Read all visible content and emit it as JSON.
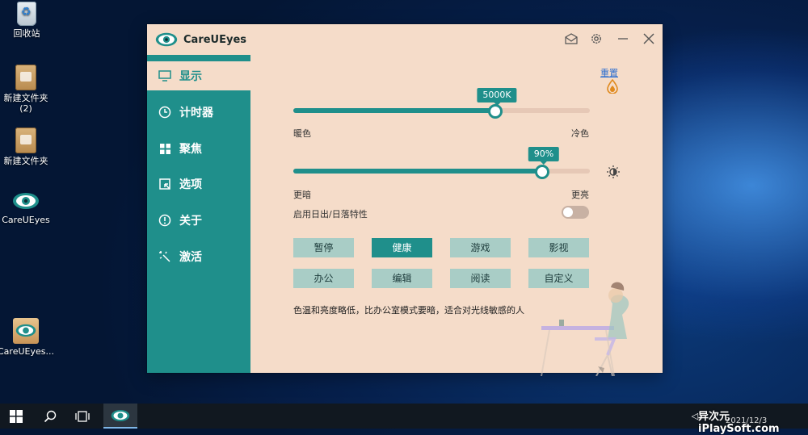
{
  "desktop": {
    "icons": [
      {
        "label": "回收站"
      },
      {
        "label": "新建文件夹\n(2)"
      },
      {
        "label": "新建文件夹"
      },
      {
        "label": "CareUEyes"
      },
      {
        "label": "CareUEyes..."
      }
    ]
  },
  "window": {
    "title": "CareUEyes",
    "sidebar": [
      {
        "label": "显示",
        "icon": "monitor-icon",
        "active": true
      },
      {
        "label": "计时器",
        "icon": "clock-icon",
        "active": false
      },
      {
        "label": "聚焦",
        "icon": "grid-icon",
        "active": false
      },
      {
        "label": "选项",
        "icon": "select-icon",
        "active": false
      },
      {
        "label": "关于",
        "icon": "info-icon",
        "active": false
      },
      {
        "label": "激活",
        "icon": "activate-icon",
        "active": false
      }
    ],
    "display": {
      "reset_label": "重置",
      "temperature": {
        "value_label": "5000K",
        "fraction": 0.68,
        "left_label": "暖色",
        "right_label": "冷色"
      },
      "brightness": {
        "value_label": "90%",
        "fraction": 0.84,
        "left_label": "更暗",
        "right_label": "更亮"
      },
      "sunrise_toggle_label": "启用日出/日落特性",
      "sunrise_toggle_on": false,
      "modes": [
        {
          "label": "暂停",
          "active": false
        },
        {
          "label": "健康",
          "active": true
        },
        {
          "label": "游戏",
          "active": false
        },
        {
          "label": "影视",
          "active": false
        },
        {
          "label": "办公",
          "active": false
        },
        {
          "label": "编辑",
          "active": false
        },
        {
          "label": "阅读",
          "active": false
        },
        {
          "label": "自定义",
          "active": false
        }
      ],
      "description": "色温和亮度略低，比办公室模式要暗，适合对光线敏感的人"
    }
  },
  "taskbar": {
    "clock_date": "2021/12/3"
  },
  "watermark": {
    "text": "异次元 iPlaySoft.com"
  },
  "colors": {
    "accent": "#1f8f8b",
    "window_bg": "#f5dcc9",
    "toggle_off": "#c8b1a3"
  }
}
